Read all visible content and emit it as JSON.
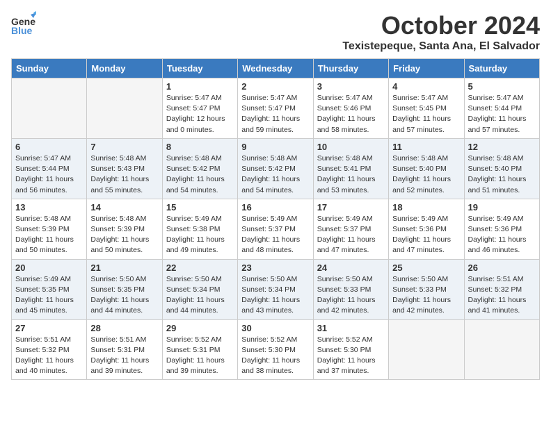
{
  "header": {
    "logo_line1": "General",
    "logo_line2": "Blue",
    "month": "October 2024",
    "location": "Texistepeque, Santa Ana, El Salvador"
  },
  "days_of_week": [
    "Sunday",
    "Monday",
    "Tuesday",
    "Wednesday",
    "Thursday",
    "Friday",
    "Saturday"
  ],
  "weeks": [
    [
      {
        "num": "",
        "detail": ""
      },
      {
        "num": "",
        "detail": ""
      },
      {
        "num": "1",
        "detail": "Sunrise: 5:47 AM\nSunset: 5:47 PM\nDaylight: 12 hours and 0 minutes."
      },
      {
        "num": "2",
        "detail": "Sunrise: 5:47 AM\nSunset: 5:47 PM\nDaylight: 11 hours and 59 minutes."
      },
      {
        "num": "3",
        "detail": "Sunrise: 5:47 AM\nSunset: 5:46 PM\nDaylight: 11 hours and 58 minutes."
      },
      {
        "num": "4",
        "detail": "Sunrise: 5:47 AM\nSunset: 5:45 PM\nDaylight: 11 hours and 57 minutes."
      },
      {
        "num": "5",
        "detail": "Sunrise: 5:47 AM\nSunset: 5:44 PM\nDaylight: 11 hours and 57 minutes."
      }
    ],
    [
      {
        "num": "6",
        "detail": "Sunrise: 5:47 AM\nSunset: 5:44 PM\nDaylight: 11 hours and 56 minutes."
      },
      {
        "num": "7",
        "detail": "Sunrise: 5:48 AM\nSunset: 5:43 PM\nDaylight: 11 hours and 55 minutes."
      },
      {
        "num": "8",
        "detail": "Sunrise: 5:48 AM\nSunset: 5:42 PM\nDaylight: 11 hours and 54 minutes."
      },
      {
        "num": "9",
        "detail": "Sunrise: 5:48 AM\nSunset: 5:42 PM\nDaylight: 11 hours and 54 minutes."
      },
      {
        "num": "10",
        "detail": "Sunrise: 5:48 AM\nSunset: 5:41 PM\nDaylight: 11 hours and 53 minutes."
      },
      {
        "num": "11",
        "detail": "Sunrise: 5:48 AM\nSunset: 5:40 PM\nDaylight: 11 hours and 52 minutes."
      },
      {
        "num": "12",
        "detail": "Sunrise: 5:48 AM\nSunset: 5:40 PM\nDaylight: 11 hours and 51 minutes."
      }
    ],
    [
      {
        "num": "13",
        "detail": "Sunrise: 5:48 AM\nSunset: 5:39 PM\nDaylight: 11 hours and 50 minutes."
      },
      {
        "num": "14",
        "detail": "Sunrise: 5:48 AM\nSunset: 5:39 PM\nDaylight: 11 hours and 50 minutes."
      },
      {
        "num": "15",
        "detail": "Sunrise: 5:49 AM\nSunset: 5:38 PM\nDaylight: 11 hours and 49 minutes."
      },
      {
        "num": "16",
        "detail": "Sunrise: 5:49 AM\nSunset: 5:37 PM\nDaylight: 11 hours and 48 minutes."
      },
      {
        "num": "17",
        "detail": "Sunrise: 5:49 AM\nSunset: 5:37 PM\nDaylight: 11 hours and 47 minutes."
      },
      {
        "num": "18",
        "detail": "Sunrise: 5:49 AM\nSunset: 5:36 PM\nDaylight: 11 hours and 47 minutes."
      },
      {
        "num": "19",
        "detail": "Sunrise: 5:49 AM\nSunset: 5:36 PM\nDaylight: 11 hours and 46 minutes."
      }
    ],
    [
      {
        "num": "20",
        "detail": "Sunrise: 5:49 AM\nSunset: 5:35 PM\nDaylight: 11 hours and 45 minutes."
      },
      {
        "num": "21",
        "detail": "Sunrise: 5:50 AM\nSunset: 5:35 PM\nDaylight: 11 hours and 44 minutes."
      },
      {
        "num": "22",
        "detail": "Sunrise: 5:50 AM\nSunset: 5:34 PM\nDaylight: 11 hours and 44 minutes."
      },
      {
        "num": "23",
        "detail": "Sunrise: 5:50 AM\nSunset: 5:34 PM\nDaylight: 11 hours and 43 minutes."
      },
      {
        "num": "24",
        "detail": "Sunrise: 5:50 AM\nSunset: 5:33 PM\nDaylight: 11 hours and 42 minutes."
      },
      {
        "num": "25",
        "detail": "Sunrise: 5:50 AM\nSunset: 5:33 PM\nDaylight: 11 hours and 42 minutes."
      },
      {
        "num": "26",
        "detail": "Sunrise: 5:51 AM\nSunset: 5:32 PM\nDaylight: 11 hours and 41 minutes."
      }
    ],
    [
      {
        "num": "27",
        "detail": "Sunrise: 5:51 AM\nSunset: 5:32 PM\nDaylight: 11 hours and 40 minutes."
      },
      {
        "num": "28",
        "detail": "Sunrise: 5:51 AM\nSunset: 5:31 PM\nDaylight: 11 hours and 39 minutes."
      },
      {
        "num": "29",
        "detail": "Sunrise: 5:52 AM\nSunset: 5:31 PM\nDaylight: 11 hours and 39 minutes."
      },
      {
        "num": "30",
        "detail": "Sunrise: 5:52 AM\nSunset: 5:30 PM\nDaylight: 11 hours and 38 minutes."
      },
      {
        "num": "31",
        "detail": "Sunrise: 5:52 AM\nSunset: 5:30 PM\nDaylight: 11 hours and 37 minutes."
      },
      {
        "num": "",
        "detail": ""
      },
      {
        "num": "",
        "detail": ""
      }
    ]
  ]
}
